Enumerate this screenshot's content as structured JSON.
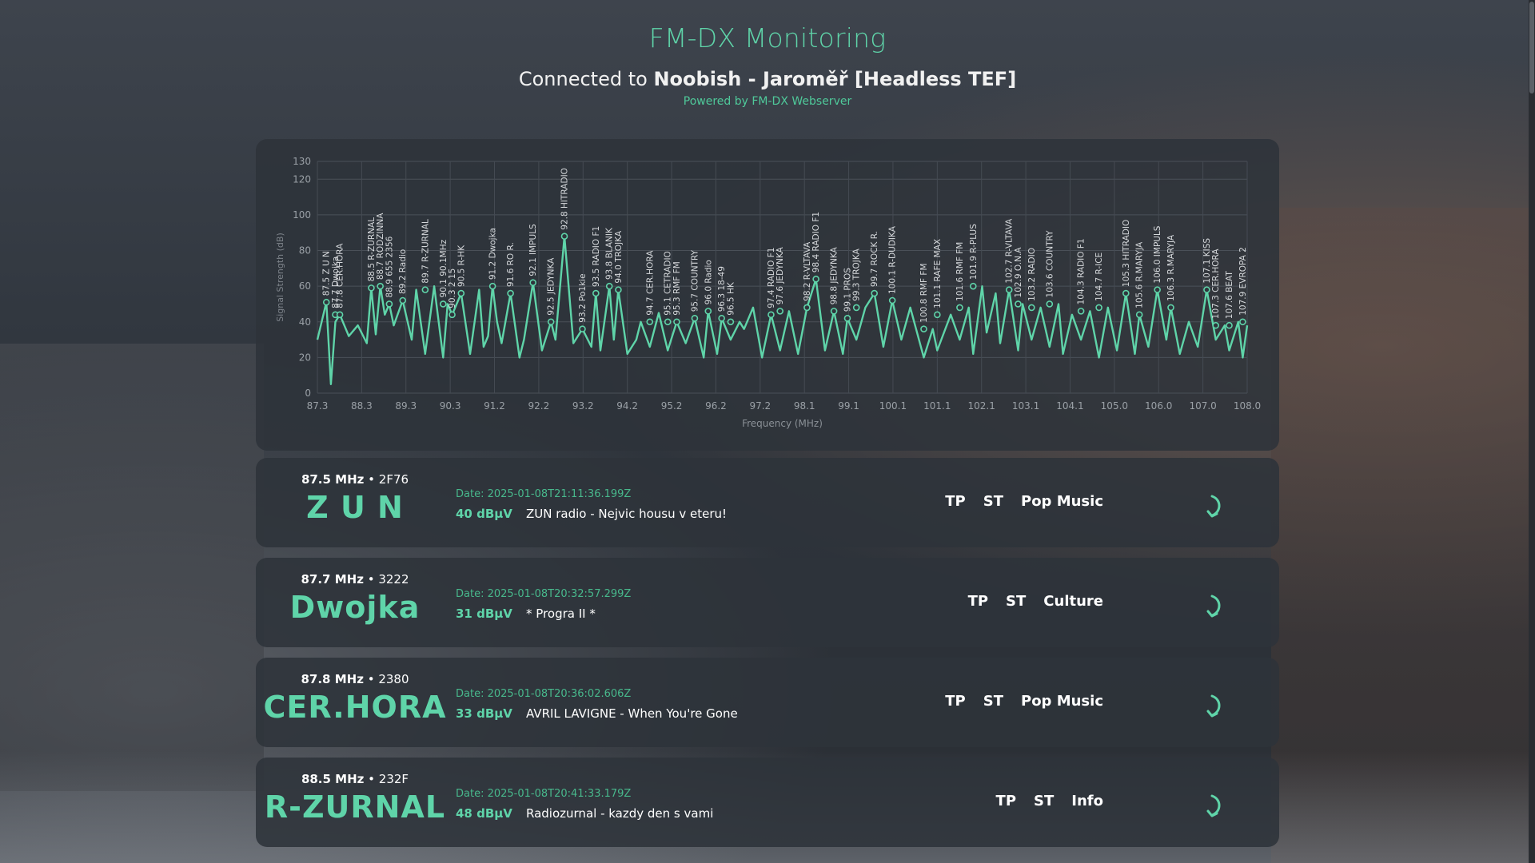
{
  "header": {
    "title": "FM-DX Monitoring",
    "connected_prefix": "Connected to",
    "server_name": "Noobish - Jaroměř [Headless TEF]",
    "powered_by": "Powered by FM-DX Webserver"
  },
  "chart_data": {
    "type": "line",
    "xlabel": "Frequency (MHz)",
    "ylabel": "Signal Strength (dB)",
    "xlim": [
      87.3,
      108.0
    ],
    "ylim": [
      0,
      130
    ],
    "x_ticks": [
      "87.3",
      "88.3",
      "89.3",
      "90.3",
      "91.2",
      "92.2",
      "93.2",
      "94.2",
      "95.2",
      "96.2",
      "97.2",
      "98.1",
      "99.1",
      "100.1",
      "101.1",
      "102.1",
      "103.1",
      "104.1",
      "105.0",
      "106.0",
      "107.0",
      "108.0"
    ],
    "y_ticks": [
      0,
      20,
      40,
      60,
      80,
      100,
      120,
      130
    ],
    "line_color": "#5fd4a9",
    "series": [
      {
        "x": [
          87.3,
          87.5,
          87.6,
          87.7,
          87.8,
          88.0,
          88.2,
          88.4,
          88.5,
          88.6,
          88.7,
          88.8,
          88.9,
          89.0,
          89.2,
          89.4,
          89.5,
          89.7,
          89.9,
          90.1,
          90.2,
          90.3,
          90.5,
          90.7,
          90.9,
          91.0,
          91.1,
          91.2,
          91.3,
          91.4,
          91.6,
          91.8,
          91.9,
          92.1,
          92.3,
          92.5,
          92.6,
          92.8,
          93.0,
          93.2,
          93.4,
          93.5,
          93.6,
          93.8,
          93.9,
          94.0,
          94.2,
          94.4,
          94.5,
          94.7,
          94.9,
          95.1,
          95.3,
          95.5,
          95.7,
          95.9,
          96.0,
          96.2,
          96.3,
          96.5,
          96.7,
          96.8,
          97.0,
          97.2,
          97.4,
          97.6,
          97.8,
          98.0,
          98.2,
          98.4,
          98.6,
          98.8,
          99.0,
          99.1,
          99.3,
          99.5,
          99.7,
          99.9,
          100.1,
          100.3,
          100.5,
          100.8,
          101.0,
          101.1,
          101.4,
          101.6,
          101.8,
          101.9,
          102.1,
          102.2,
          102.4,
          102.5,
          102.7,
          102.9,
          103.0,
          103.2,
          103.4,
          103.6,
          103.8,
          103.9,
          104.1,
          104.3,
          104.5,
          104.7,
          104.9,
          105.1,
          105.3,
          105.5,
          105.6,
          105.8,
          106.0,
          106.2,
          106.3,
          106.5,
          106.7,
          106.9,
          107.1,
          107.3,
          107.5,
          107.6,
          107.8,
          107.9,
          108.0
        ],
        "y": [
          30,
          51,
          5,
          40,
          44,
          32,
          38,
          28,
          59,
          33,
          60,
          44,
          50,
          38,
          52,
          30,
          58,
          22,
          60,
          20,
          50,
          44,
          56,
          22,
          58,
          26,
          32,
          60,
          40,
          28,
          56,
          20,
          30,
          62,
          24,
          40,
          30,
          88,
          28,
          36,
          26,
          56,
          24,
          60,
          30,
          58,
          22,
          30,
          40,
          26,
          45,
          24,
          40,
          28,
          42,
          20,
          46,
          22,
          42,
          30,
          40,
          36,
          48,
          20,
          44,
          24,
          46,
          22,
          48,
          64,
          24,
          46,
          22,
          42,
          30,
          48,
          56,
          26,
          52,
          30,
          48,
          20,
          36,
          24,
          44,
          30,
          48,
          22,
          60,
          34,
          56,
          28,
          58,
          24,
          50,
          30,
          48,
          26,
          50,
          22,
          44,
          30,
          46,
          20,
          48,
          24,
          56,
          22,
          44,
          26,
          58,
          30,
          48,
          22,
          40,
          26,
          58,
          30,
          38,
          24,
          40,
          20,
          38
        ]
      }
    ],
    "peak_labels": [
      {
        "x": 87.5,
        "y": 51,
        "text": "87.5 Z U N"
      },
      {
        "x": 87.7,
        "y": 44,
        "text": "87.7 Dwojka"
      },
      {
        "x": 87.8,
        "y": 44,
        "text": "87.8 CER.HORA"
      },
      {
        "x": 88.5,
        "y": 59,
        "text": "88.5 R-ZURNAL"
      },
      {
        "x": 88.7,
        "y": 60,
        "text": "88.7 RODZINNA"
      },
      {
        "x": 88.9,
        "y": 50,
        "text": "88.9 655 2356"
      },
      {
        "x": 89.2,
        "y": 52,
        "text": "89.2 Radio"
      },
      {
        "x": 89.7,
        "y": 58,
        "text": "89.7 R-ZURNAL"
      },
      {
        "x": 90.1,
        "y": 50,
        "text": "90.1 90.1MHz"
      },
      {
        "x": 90.3,
        "y": 44,
        "text": "90.3 2 15"
      },
      {
        "x": 90.5,
        "y": 56,
        "text": "90.5 R-HK"
      },
      {
        "x": 91.2,
        "y": 60,
        "text": "91.2 Dwojka"
      },
      {
        "x": 91.6,
        "y": 56,
        "text": "91.6 RO R."
      },
      {
        "x": 92.1,
        "y": 62,
        "text": "92.1 IMPULS"
      },
      {
        "x": 92.5,
        "y": 40,
        "text": "92.5 JEDYNKA"
      },
      {
        "x": 92.8,
        "y": 88,
        "text": "92.8 HITRADIO"
      },
      {
        "x": 93.2,
        "y": 36,
        "text": "93.2 Po1kie"
      },
      {
        "x": 93.5,
        "y": 56,
        "text": "93.5 RADIO F1"
      },
      {
        "x": 93.8,
        "y": 60,
        "text": "93.8 BLANIK"
      },
      {
        "x": 94.0,
        "y": 58,
        "text": "94.0 TROJKA"
      },
      {
        "x": 94.7,
        "y": 40,
        "text": "94.7 CER.HORA"
      },
      {
        "x": 95.1,
        "y": 40,
        "text": "95.1 CETRADIO"
      },
      {
        "x": 95.3,
        "y": 40,
        "text": "95.3 RMF FM"
      },
      {
        "x": 95.7,
        "y": 42,
        "text": "95.7 COUNTRY"
      },
      {
        "x": 96.0,
        "y": 46,
        "text": "96.0 Radio"
      },
      {
        "x": 96.3,
        "y": 42,
        "text": "96.3 18-49"
      },
      {
        "x": 96.5,
        "y": 40,
        "text": "96.5 HK"
      },
      {
        "x": 97.4,
        "y": 44,
        "text": "97.4 RADIO F1"
      },
      {
        "x": 97.6,
        "y": 46,
        "text": "97.6 JEDYNKA"
      },
      {
        "x": 98.2,
        "y": 48,
        "text": "98.2 R-VLTAVA"
      },
      {
        "x": 98.4,
        "y": 64,
        "text": "98.4 RADIO F1"
      },
      {
        "x": 98.8,
        "y": 46,
        "text": "98.8 JEDYNKA"
      },
      {
        "x": 99.1,
        "y": 42,
        "text": "99.1 PROS"
      },
      {
        "x": 99.3,
        "y": 48,
        "text": "99.3 TROJKA"
      },
      {
        "x": 99.7,
        "y": 56,
        "text": "99.7 ROCK R."
      },
      {
        "x": 100.1,
        "y": 52,
        "text": "100.1 R-DUDIKA"
      },
      {
        "x": 100.8,
        "y": 36,
        "text": "100.8 RMF FM"
      },
      {
        "x": 101.1,
        "y": 44,
        "text": "101.1 RAFE MAX"
      },
      {
        "x": 101.6,
        "y": 48,
        "text": "101.6 RMF FM"
      },
      {
        "x": 101.9,
        "y": 60,
        "text": "101.9 R-PLUS"
      },
      {
        "x": 102.7,
        "y": 58,
        "text": "102.7 R-VLTAVA"
      },
      {
        "x": 102.9,
        "y": 50,
        "text": "102.9 O.N.A"
      },
      {
        "x": 103.2,
        "y": 48,
        "text": "103.2 RADIO"
      },
      {
        "x": 103.6,
        "y": 50,
        "text": "103.6 COUNTRY"
      },
      {
        "x": 104.3,
        "y": 46,
        "text": "104.3 RADIO F1"
      },
      {
        "x": 104.7,
        "y": 48,
        "text": "104.7 R-ICE"
      },
      {
        "x": 105.3,
        "y": 56,
        "text": "105.3 HITRADIO"
      },
      {
        "x": 105.6,
        "y": 44,
        "text": "105.6 R.MARYJA"
      },
      {
        "x": 106.0,
        "y": 58,
        "text": "106.0 IMPULS"
      },
      {
        "x": 106.3,
        "y": 48,
        "text": "106.3 R.MARYJA"
      },
      {
        "x": 107.1,
        "y": 58,
        "text": "107.1 KISS"
      },
      {
        "x": 107.3,
        "y": 38,
        "text": "107.3 CER.HORA"
      },
      {
        "x": 107.6,
        "y": 38,
        "text": "107.6 BEAT"
      },
      {
        "x": 107.9,
        "y": 40,
        "text": "107.9 EVROPA 2"
      }
    ]
  },
  "stations": [
    {
      "freq": "87.5 MHz",
      "pi": "2F76",
      "ps": "Z U N",
      "date": "Date: 2025-01-08T21:11:36.199Z",
      "signal": "40 dBµV",
      "rt": "ZUN radio - Nejvic housu v eteru!",
      "tp": "TP",
      "st": "ST",
      "pty": "Pop Music"
    },
    {
      "freq": "87.7 MHz",
      "pi": "3222",
      "ps": "Dwojka",
      "date": "Date: 2025-01-08T20:32:57.299Z",
      "signal": "31 dBµV",
      "rt": "* Progra II *",
      "tp": "TP",
      "st": "ST",
      "pty": "Culture"
    },
    {
      "freq": "87.8 MHz",
      "pi": "2380",
      "ps": "CER.HORA",
      "date": "Date: 2025-01-08T20:36:02.606Z",
      "signal": "33 dBµV",
      "rt": "AVRIL LAVIGNE - When You're Gone",
      "tp": "TP",
      "st": "ST",
      "pty": "Pop Music"
    },
    {
      "freq": "88.5 MHz",
      "pi": "232F",
      "ps": "R-ZURNAL",
      "date": "Date: 2025-01-08T20:41:33.179Z",
      "signal": "48 dBµV",
      "rt": "Radiozurnal - kazdy den s vami",
      "tp": "TP",
      "st": "ST",
      "pty": "Info"
    }
  ],
  "separator": " • ",
  "icons": {
    "row_action": "refresh-arrow-icon"
  }
}
